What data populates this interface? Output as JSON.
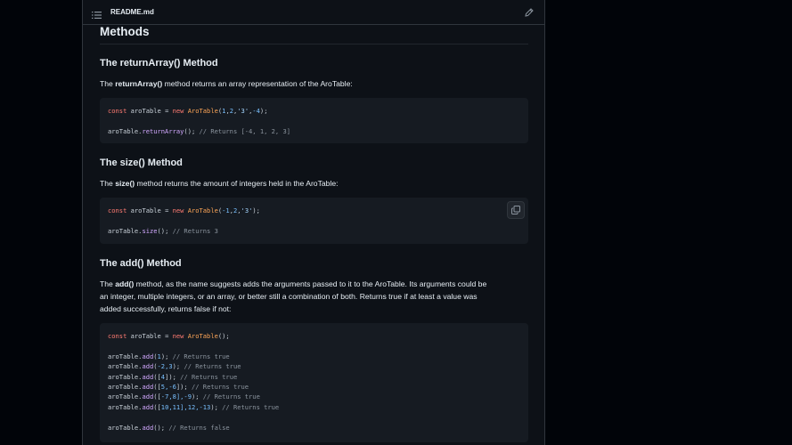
{
  "file": {
    "name": "README.md"
  },
  "icons": {
    "list": "list-unordered-icon",
    "edit": "pencil-icon",
    "copy": "copy-icon"
  },
  "methods_heading": "Methods",
  "returnArray": {
    "heading": "The returnArray() Method",
    "para_pre": "The ",
    "para_bold": "returnArray()",
    "para_post": " method returns an array representation of the AroTable:",
    "code": {
      "l1_kw": "const",
      "l1_var": " aroTable = ",
      "l1_new": "new",
      "l1_cls": "AroTable",
      "l1_args_open": "(",
      "l1_n1": "1",
      "l1_c1": ",",
      "l1_n2": "2",
      "l1_c2": ",",
      "l1_s1": "'3'",
      "l1_c3": ",",
      "l1_n3": "-4",
      "l1_close": ");",
      "l3_obj": "aroTable.",
      "l3_fn": "returnArray",
      "l3_rest": "(); ",
      "l3_cm": "// Returns [-4, 1, 2, 3]"
    }
  },
  "size": {
    "heading": "The size() Method",
    "para_pre": "The ",
    "para_bold": "size()",
    "para_post": " method returns the amount of integers held in the AroTable:",
    "code": {
      "l1_kw": "const",
      "l1_var": " aroTable = ",
      "l1_new": "new",
      "l1_cls": "AroTable",
      "l1_open": "(",
      "l1_n1": "-1",
      "l1_c1": ",",
      "l1_n2": "2",
      "l1_c2": ",",
      "l1_s1": "'3'",
      "l1_close": ");",
      "l3_obj": "aroTable.",
      "l3_fn": "size",
      "l3_rest": "(); ",
      "l3_cm": "// Returns 3"
    }
  },
  "add": {
    "heading": "The add() Method",
    "para_pre": "The ",
    "para_bold": "add()",
    "para_line1": " method, as the name suggests adds the arguments passed to it to the AroTable. Its arguments could be",
    "para_line2": "an integer, multiple integers, or an array, or better still a combination of both. Returns true if at least a value was",
    "para_line3": "added successfully, returns false if not:",
    "code": {
      "l1_kw": "const",
      "l1_var": " aroTable = ",
      "l1_new": "new",
      "l1_cls": "AroTable",
      "l1_close": "();",
      "obj": "aroTable.",
      "fn": "add",
      "lines": [
        {
          "open": "(",
          "args": "1",
          "close": "); ",
          "cm": "// Returns true"
        },
        {
          "open": "(",
          "args": "-2,3",
          "close": "); ",
          "cm": "// Returns true"
        },
        {
          "open": "([",
          "args": "4",
          "close": "]); ",
          "cm": "// Returns true"
        },
        {
          "open": "([",
          "args": "5,-6",
          "close": "]); ",
          "cm": "// Returns true"
        },
        {
          "open": "([",
          "args": "-7,8],-9",
          "close": "); ",
          "cm": "// Returns true"
        },
        {
          "open": "([",
          "args": "10,11],12,-13",
          "close": "); ",
          "cm": "// Returns true"
        }
      ],
      "last_rest": "(); ",
      "last_cm": "// Returns false"
    }
  }
}
